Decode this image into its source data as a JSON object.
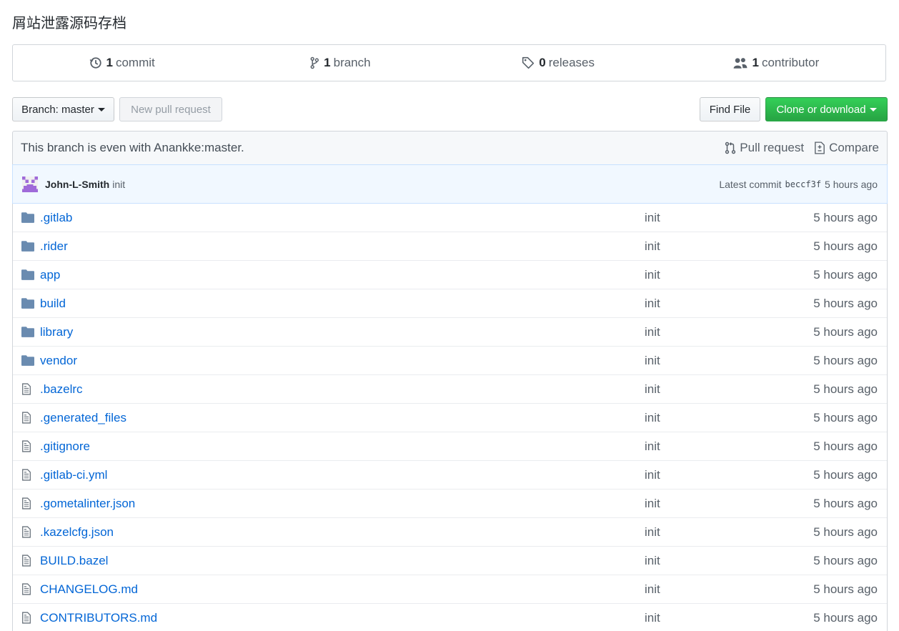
{
  "repo_title": "屑站泄露源码存档",
  "summary": {
    "commits_count": "1",
    "commits_label": "commit",
    "branches_count": "1",
    "branches_label": "branch",
    "releases_count": "0",
    "releases_label": "releases",
    "contributors_count": "1",
    "contributors_label": "contributor"
  },
  "toolbar": {
    "branch_label": "Branch: master",
    "new_pr_label": "New pull request",
    "find_file_label": "Find File",
    "clone_label": "Clone or download"
  },
  "branch_info": {
    "text": "This branch is even with Anankke:master.",
    "pull_request_label": "Pull request",
    "compare_label": "Compare"
  },
  "commit": {
    "author": "John-L-Smith",
    "message": "init",
    "latest_label": "Latest commit",
    "sha": "beccf3f",
    "age": "5 hours ago"
  },
  "colors": {
    "link": "#0366d6",
    "folder_icon": "#79b8ff",
    "green_button": "#28a745",
    "avatar": "#9f6ad9"
  },
  "files": [
    {
      "type": "dir",
      "name": ".gitlab",
      "message": "init",
      "age": "5 hours ago"
    },
    {
      "type": "dir",
      "name": ".rider",
      "message": "init",
      "age": "5 hours ago"
    },
    {
      "type": "dir",
      "name": "app",
      "message": "init",
      "age": "5 hours ago"
    },
    {
      "type": "dir",
      "name": "build",
      "message": "init",
      "age": "5 hours ago"
    },
    {
      "type": "dir",
      "name": "library",
      "message": "init",
      "age": "5 hours ago"
    },
    {
      "type": "dir",
      "name": "vendor",
      "message": "init",
      "age": "5 hours ago"
    },
    {
      "type": "file",
      "name": ".bazelrc",
      "message": "init",
      "age": "5 hours ago"
    },
    {
      "type": "file",
      "name": ".generated_files",
      "message": "init",
      "age": "5 hours ago"
    },
    {
      "type": "file",
      "name": ".gitignore",
      "message": "init",
      "age": "5 hours ago"
    },
    {
      "type": "file",
      "name": ".gitlab-ci.yml",
      "message": "init",
      "age": "5 hours ago"
    },
    {
      "type": "file",
      "name": ".gometalinter.json",
      "message": "init",
      "age": "5 hours ago"
    },
    {
      "type": "file",
      "name": ".kazelcfg.json",
      "message": "init",
      "age": "5 hours ago"
    },
    {
      "type": "file",
      "name": "BUILD.bazel",
      "message": "init",
      "age": "5 hours ago"
    },
    {
      "type": "file",
      "name": "CHANGELOG.md",
      "message": "init",
      "age": "5 hours ago"
    },
    {
      "type": "file",
      "name": "CONTRIBUTORS.md",
      "message": "init",
      "age": "5 hours ago"
    }
  ]
}
